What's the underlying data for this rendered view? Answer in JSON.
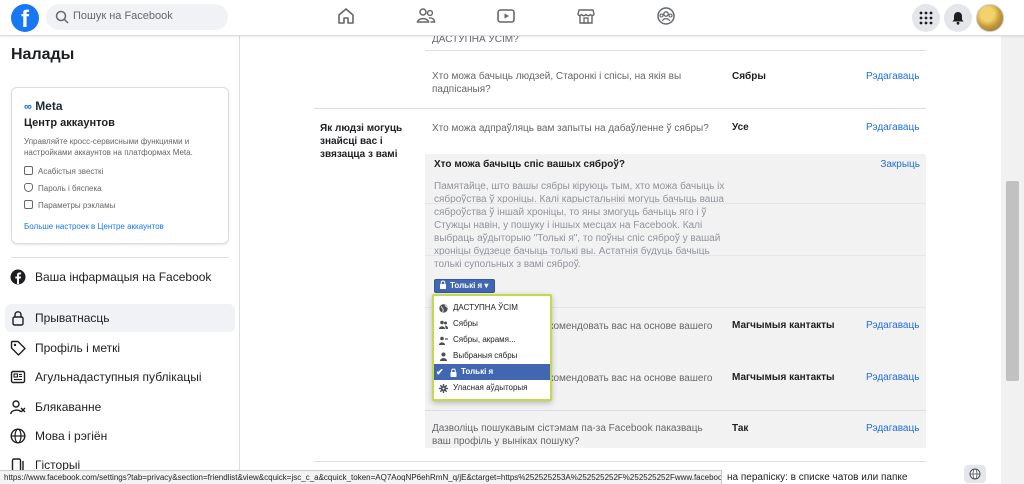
{
  "topbar": {
    "logo": "f",
    "search_placeholder": "Пошук на Facebook"
  },
  "sidebar": {
    "title": "Налады",
    "meta": {
      "logo": "Meta",
      "title": "Центр аккаунтов",
      "description": "Управляйте кросс-сервисными функциями и настройками аккаунтов на платформах Meta.",
      "items": [
        "Асабістыя звесткі",
        "Пароль і бяспека",
        "Параметры рэкламы"
      ],
      "link": "Больше настроек в Центре аккаунтов"
    },
    "items": [
      {
        "label": "Ваша інфармацыя на Facebook",
        "icon": "facebook-icon"
      },
      {
        "label": "Прыватнасць",
        "icon": "lock-icon"
      },
      {
        "label": "Профіль і меткі",
        "icon": "tag-icon"
      },
      {
        "label": "Агульнадаступныя публікацыі",
        "icon": "news-icon"
      },
      {
        "label": "Блякаванне",
        "icon": "block-user-icon"
      },
      {
        "label": "Мова і рэгіён",
        "icon": "globe-icon"
      },
      {
        "label": "Гісторыі",
        "icon": "stories-icon"
      }
    ]
  },
  "main": {
    "top_cut_text": "ДАСТУПНА ЎСІМ?",
    "row_following": {
      "question": "Хто можа бачыць людзей, Старонкі і спісы, на якія вы падпісаныя?",
      "value": "Сябры",
      "edit": "Рэдагаваць"
    },
    "section_title": "Як людзі могуць знайсці вас і звязацца з вамі",
    "row_requests": {
      "question": "Хто можа адпраўляць вам запыты на дабаўленне ў сябры?",
      "value": "Усе",
      "edit": "Рэдагаваць"
    },
    "expanded": {
      "title": "Хто можа бачыць спіс вашых сяброў?",
      "close": "Закрыць",
      "description": "Памятайце, што вашы сябры кіруюць тым, хто можа бачыць іх сяброўства ў хроніцы. Калі карыстальнікі могуць бачыць ваша сяброўства ў іншай хроніцы, то яны змогуць бачыць яго і ў Стужцы навін, у пошуку і іншых месцах на Facebook. Калі выбраць аўдыторыю \"Толькі я\", то поўны спіс сяброў у вашай хроніцы будзеце бачыць толькі вы. Астатнія будуць бачыць толькі супольных з вамі сяброў.",
      "audience_button": "Толькі я"
    },
    "row_email": {
      "question_tail": "комендовать вас на основе вашего",
      "value": "Магчымыя кантакты",
      "edit": "Рэдагаваць"
    },
    "row_phone": {
      "question_tail": "комендовать вас на основе вашего",
      "value": "Магчымыя кантакты",
      "edit": "Рэдагаваць"
    },
    "row_search": {
      "question": "Дазволіць пошукавым сістэмам па-за Facebook паказваць ваш профіль у выніках пошуку?",
      "value": "Так",
      "edit": "Рэдагаваць"
    },
    "bottom_cut_text": "на перапіску: в списке чатов или папке"
  },
  "dropdown": {
    "items": [
      {
        "label": "ДАСТУПНА ЎСІМ",
        "icon": "globe-icon"
      },
      {
        "label": "Сябры",
        "icon": "friends-icon"
      },
      {
        "label": "Сябры, акрамя...",
        "icon": "friends-except-icon"
      },
      {
        "label": "Выбраныя сябры",
        "icon": "specific-friends-icon"
      },
      {
        "label": "Толькі я",
        "icon": "lock-icon",
        "selected": true
      },
      {
        "label": "Уласная аўдыторыя",
        "icon": "gear-icon"
      }
    ]
  },
  "status_bar": {
    "url": "https://www.facebook.com/settings?tab=privacy&section=friendlist&view&cquick=jsc_c_a&cquick_token=AQ7AoqNP6ehRmN_q/jE&ctarget=https%252525253A%252525252F%252525252Fwww.facebook.com#"
  },
  "colors": {
    "brand": "#1877f2",
    "link": "#216fdb",
    "button": "#4267b2",
    "highlight": "#c5d94a"
  }
}
